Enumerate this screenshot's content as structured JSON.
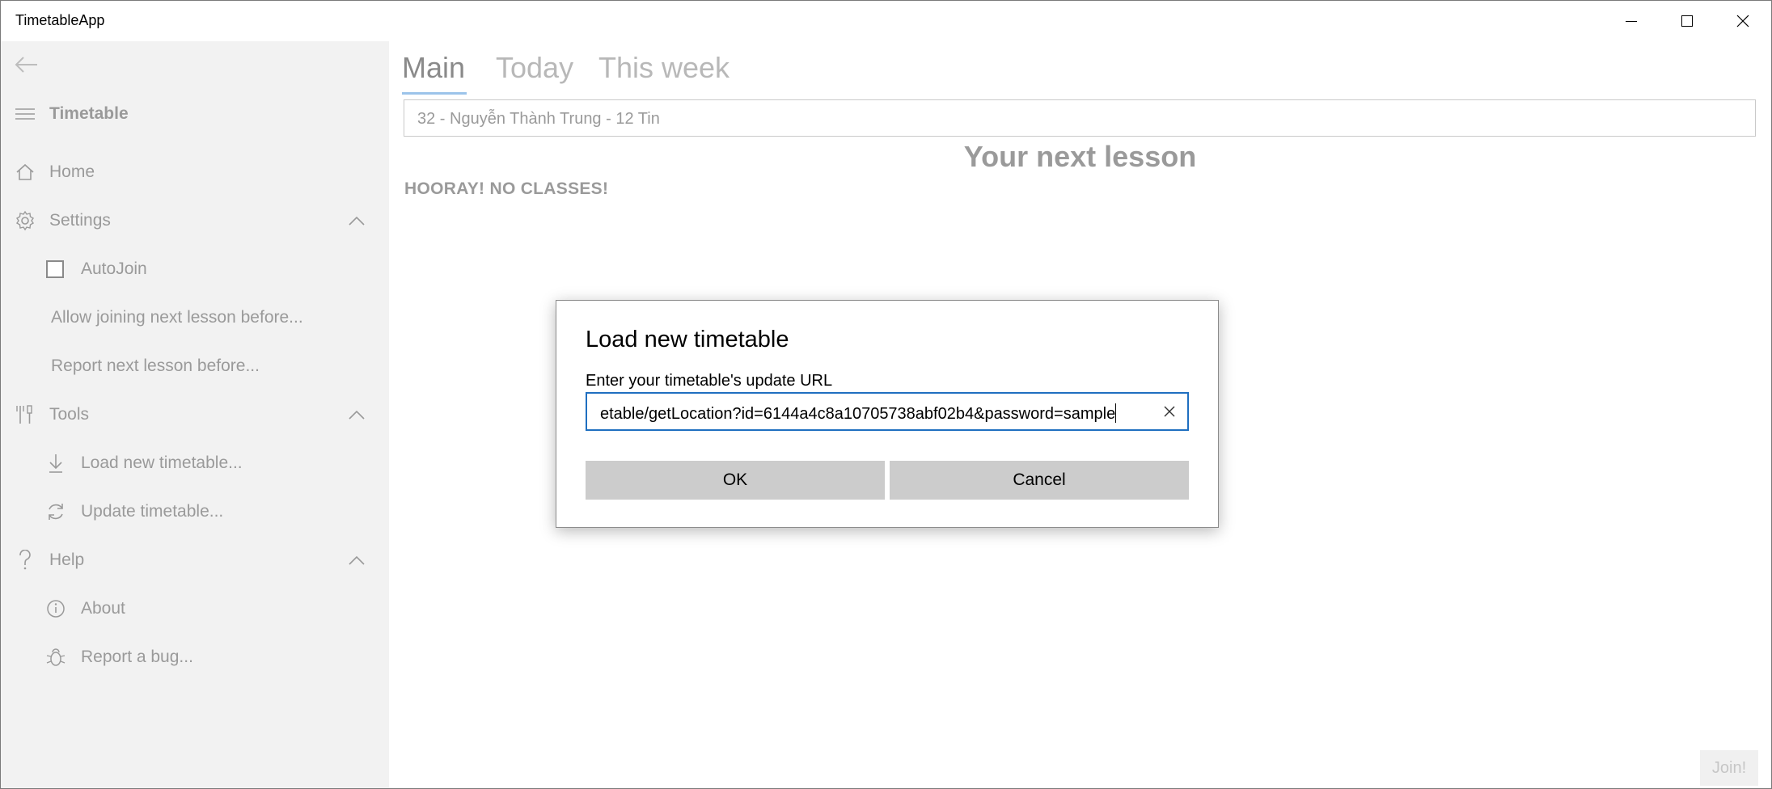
{
  "app": {
    "title": "TimetableApp"
  },
  "sidebar": {
    "header": "Timetable",
    "items": [
      {
        "label": "Home",
        "icon": "home-icon"
      },
      {
        "label": "Settings",
        "icon": "gear-icon",
        "expanded": true,
        "children": [
          {
            "label": "AutoJoin",
            "type": "checkbox",
            "checked": false
          },
          {
            "label": "Allow joining next lesson before..."
          },
          {
            "label": "Report next lesson before..."
          }
        ]
      },
      {
        "label": "Tools",
        "icon": "tools-icon",
        "expanded": true,
        "children": [
          {
            "label": "Load new timetable...",
            "icon": "download-icon"
          },
          {
            "label": "Update timetable...",
            "icon": "refresh-icon"
          }
        ]
      },
      {
        "label": "Help",
        "icon": "question-icon",
        "expanded": true,
        "children": [
          {
            "label": "About",
            "icon": "info-icon"
          },
          {
            "label": "Report a bug...",
            "icon": "bug-icon"
          }
        ]
      }
    ]
  },
  "main": {
    "tabs": [
      {
        "label": "Main",
        "active": true
      },
      {
        "label": "Today",
        "active": false
      },
      {
        "label": "This week",
        "active": false
      }
    ],
    "student_selector": "32 - Nguyễn Thành Trung - 12 Tin",
    "next_lesson_title": "Your next lesson",
    "no_classes_text": "HOORAY! NO CLASSES!",
    "join_label": "Join!"
  },
  "dialog": {
    "title": "Load new timetable",
    "label": "Enter your timetable's update URL",
    "url_value": "etable/getLocation?id=6144a4c8a10705738abf02b4&password=sample",
    "ok_label": "OK",
    "cancel_label": "Cancel"
  },
  "colors": {
    "accent": "#1f6fc0",
    "dim_text": "#9a9a9a",
    "sidebar_bg": "#f2f2f2",
    "button_bg": "#cccccc"
  }
}
